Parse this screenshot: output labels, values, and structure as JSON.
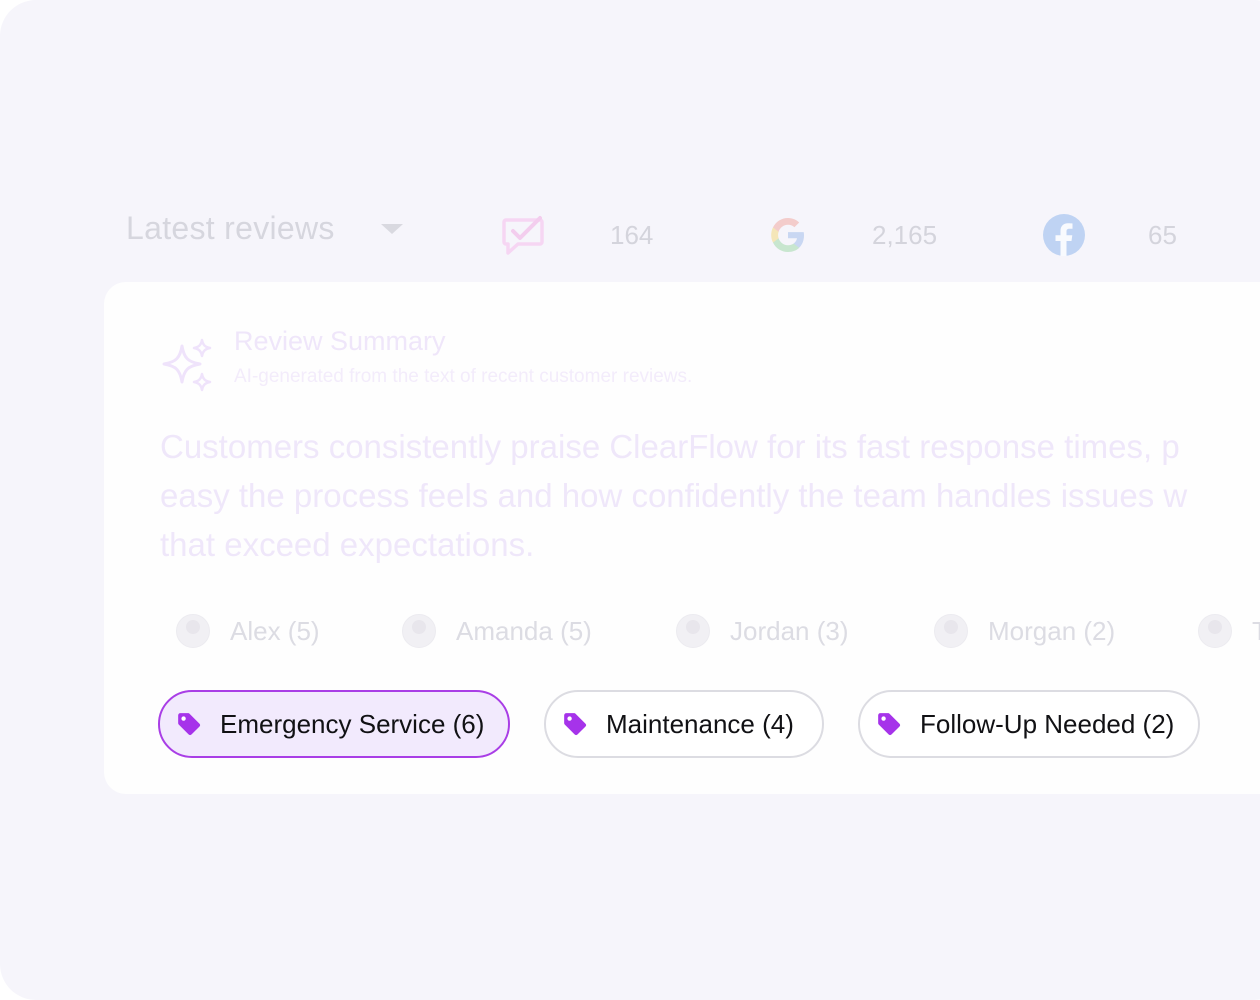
{
  "header": {
    "dropdown_label": "Latest reviews",
    "sources": [
      {
        "icon": "review-check-icon",
        "count": "164",
        "color": "#f6d6f3"
      },
      {
        "icon": "google-icon",
        "count": "2,165"
      },
      {
        "icon": "facebook-icon",
        "count": "65",
        "color": "#bfd3f3"
      }
    ]
  },
  "summary": {
    "title": "Review Summary",
    "subtitle": "AI-generated from the text of recent customer reviews.",
    "lines": [
      "Customers consistently praise ClearFlow for its fast response times, p",
      "easy the process feels and how confidently the team handles issues w",
      "that exceed expectations."
    ]
  },
  "people": [
    {
      "name": "Alex (5)"
    },
    {
      "name": "Amanda (5)"
    },
    {
      "name": "Jordan (3)"
    },
    {
      "name": "Morgan (2)"
    },
    {
      "name": "T"
    }
  ],
  "tags": [
    {
      "label": "Emergency Service (6)",
      "selected": true
    },
    {
      "label": "Maintenance (4)",
      "selected": false
    },
    {
      "label": "Follow-Up Needed (2)",
      "selected": false
    }
  ],
  "colors": {
    "accent": "#a93ee6",
    "tag_icon": "#a633ea",
    "selected_chip_bg": "#f2eafd",
    "background": "#f6f5fb"
  }
}
